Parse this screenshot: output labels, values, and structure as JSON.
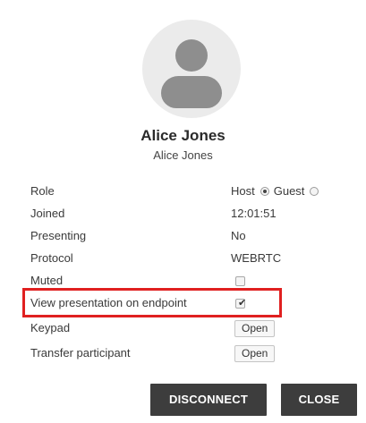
{
  "participant": {
    "display_name": "Alice Jones",
    "sub_name": "Alice Jones"
  },
  "fields": {
    "role": {
      "label": "Role",
      "options": [
        {
          "label": "Host",
          "selected": true
        },
        {
          "label": "Guest",
          "selected": false
        }
      ]
    },
    "joined": {
      "label": "Joined",
      "value": "12:01:51"
    },
    "presenting": {
      "label": "Presenting",
      "value": "No"
    },
    "protocol": {
      "label": "Protocol",
      "value": "WEBRTC"
    },
    "muted": {
      "label": "Muted",
      "checked": false
    },
    "view_presentation": {
      "label": "View presentation on endpoint",
      "checked": true
    },
    "keypad": {
      "label": "Keypad",
      "button_label": "Open"
    },
    "transfer": {
      "label": "Transfer participant",
      "button_label": "Open"
    }
  },
  "actions": {
    "disconnect_label": "DISCONNECT",
    "close_label": "CLOSE"
  },
  "colors": {
    "highlight_border": "#e02020",
    "action_button_bg": "#3d3d3d",
    "avatar_bg": "#ebebeb",
    "avatar_fg": "#8e8e8e"
  }
}
